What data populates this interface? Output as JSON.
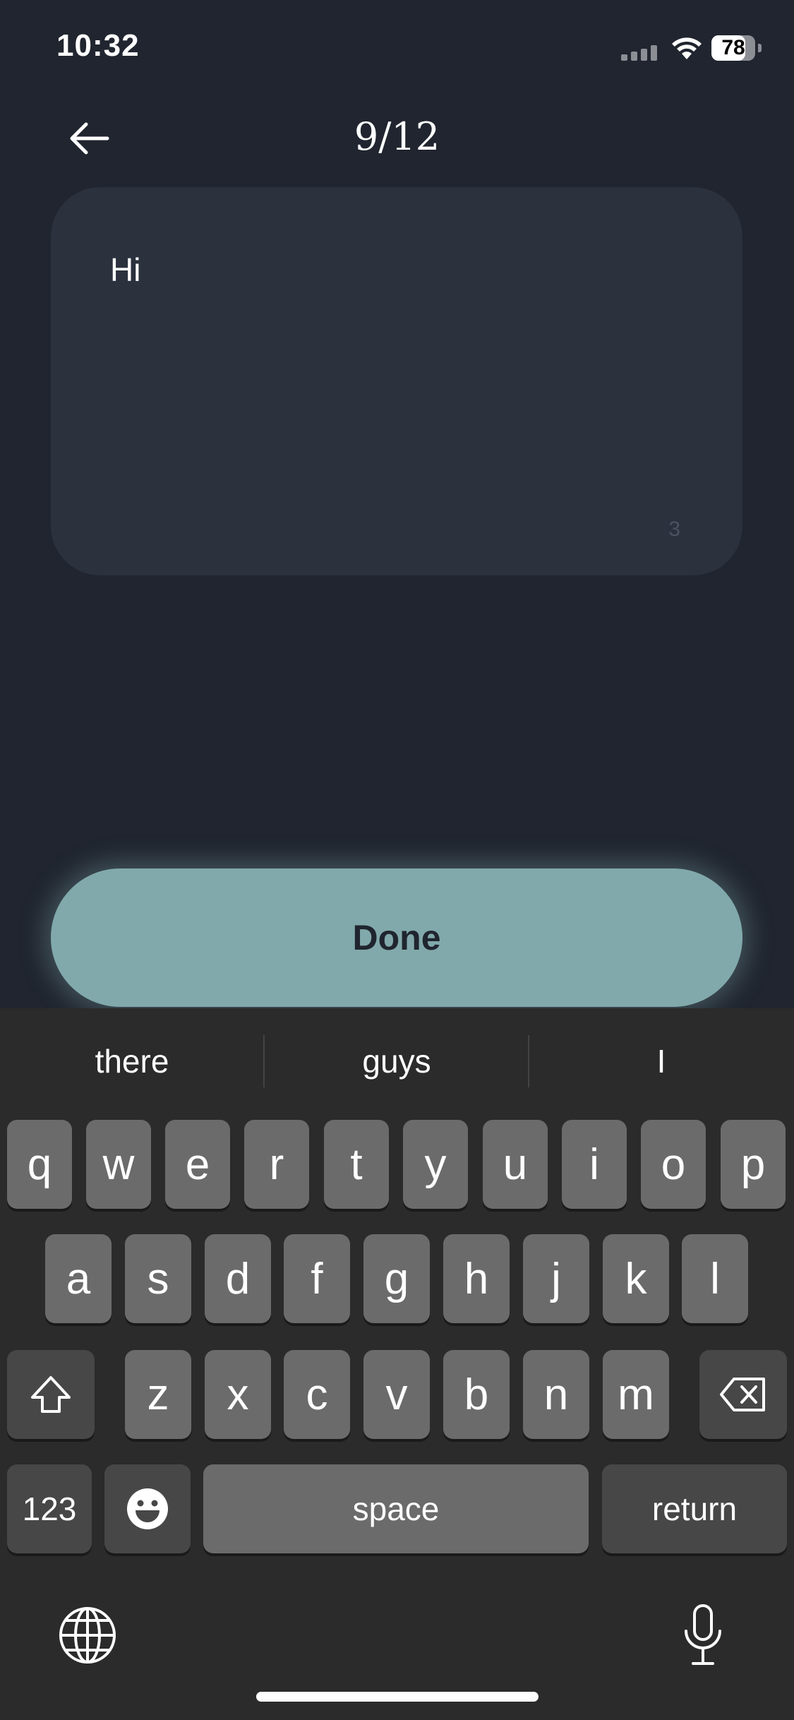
{
  "status_bar": {
    "time": "10:32",
    "battery_percent": "78"
  },
  "header": {
    "counter": "9/12"
  },
  "text_card": {
    "text": "Hi",
    "char_count": "3"
  },
  "done_button": {
    "label": "Done"
  },
  "keyboard": {
    "suggestions": [
      "there",
      "guys",
      "I"
    ],
    "row1": [
      "q",
      "w",
      "e",
      "r",
      "t",
      "y",
      "u",
      "i",
      "o",
      "p"
    ],
    "row2": [
      "a",
      "s",
      "d",
      "f",
      "g",
      "h",
      "j",
      "k",
      "l"
    ],
    "row3": [
      "z",
      "x",
      "c",
      "v",
      "b",
      "n",
      "m"
    ],
    "numbers_label": "123",
    "space_label": "space",
    "return_label": "return"
  },
  "icons": [
    "back-arrow-icon",
    "signal-icon",
    "wifi-icon",
    "battery-icon",
    "shift-icon",
    "backspace-icon",
    "emoji-icon",
    "globe-icon",
    "microphone-icon"
  ]
}
